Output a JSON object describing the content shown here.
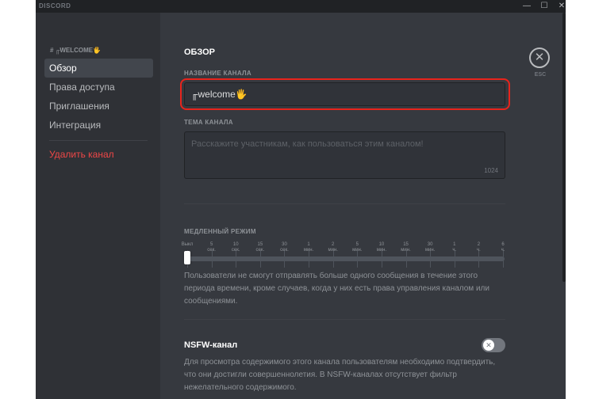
{
  "app": {
    "name": "DISCORD",
    "controls": [
      "—",
      "☐",
      "✕"
    ]
  },
  "sidebar": {
    "header": "# ╓WELCOME🖐",
    "items": [
      {
        "label": "Обзор",
        "active": true
      },
      {
        "label": "Права доступа"
      },
      {
        "label": "Приглашения"
      },
      {
        "label": "Интеграция"
      }
    ],
    "delete": "Удалить канал"
  },
  "main": {
    "title": "ОБЗОР",
    "channel_name_label": "НАЗВАНИЕ КАНАЛА",
    "channel_name_value": "╓welcome🖐",
    "topic_label": "ТЕМА КАНАЛА",
    "topic_placeholder": "Расскажите участникам, как пользоваться этим каналом!",
    "topic_counter": "1024",
    "slowmode_label": "МЕДЛЕННЫЙ РЕЖИМ",
    "slowmode_ticks": [
      [
        "Выкл",
        ""
      ],
      [
        "5",
        "сек."
      ],
      [
        "10",
        "сек."
      ],
      [
        "15",
        "сек."
      ],
      [
        "30",
        "сек."
      ],
      [
        "1",
        "мин."
      ],
      [
        "2",
        "мин."
      ],
      [
        "5",
        "мин."
      ],
      [
        "10",
        "мин."
      ],
      [
        "15",
        "мин."
      ],
      [
        "30",
        "мин."
      ],
      [
        "1",
        "ч."
      ],
      [
        "2",
        "ч."
      ],
      [
        "6",
        "ч."
      ]
    ],
    "slowmode_selected_index": 0,
    "slowmode_desc": "Пользователи не смогут отправлять больше одного сообщения в течение этого периода времени, кроме случаев, когда у них есть права управления каналом или сообщениями.",
    "nsfw_title": "NSFW-канал",
    "nsfw_enabled": false,
    "nsfw_desc": "Для просмотра содержимого этого канала пользователям необходимо подтвердить, что они достигли совершеннолетия. В NSFW-каналах отсутствует фильтр нежелательного содержимого.",
    "close_label": "ESC",
    "close_icon": "close-icon"
  },
  "colors": {
    "accent_highlight": "#e8241c",
    "danger": "#f04747",
    "background": "#36393f"
  }
}
